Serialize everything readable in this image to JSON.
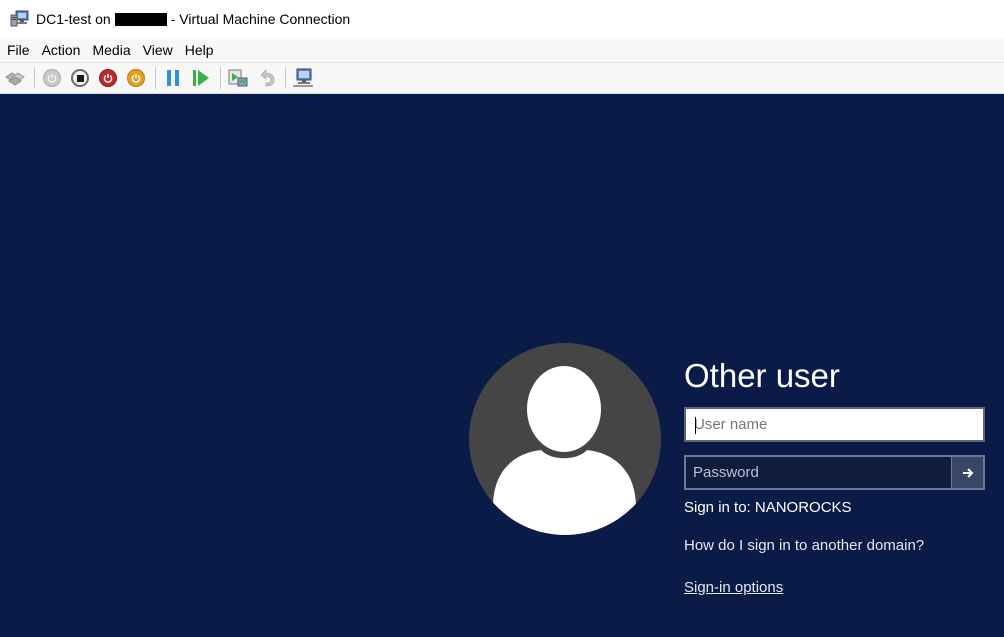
{
  "window": {
    "title_prefix": "DC1-test on",
    "title_suffix": "- Virtual Machine Connection",
    "app_icon": "vm-connection-icon"
  },
  "menu": {
    "items": [
      "File",
      "Action",
      "Media",
      "View",
      "Help"
    ]
  },
  "toolbar": {
    "buttons": [
      "ctrl-alt-del-icon",
      "start-icon",
      "turn-off-icon",
      "shut-down-icon",
      "save-icon",
      "pause-icon",
      "resume-icon",
      "checkpoint-icon",
      "revert-icon",
      "enhanced-session-icon"
    ]
  },
  "login": {
    "title": "Other user",
    "username_placeholder": "User name",
    "password_placeholder": "Password",
    "submit_icon": "arrow-right-icon",
    "sign_in_to": "Sign in to: NANOROCKS",
    "other_domain": "How do I sign in to another domain?",
    "sign_in_options": "Sign-in options"
  },
  "colors": {
    "vm_background": "#0b1b48",
    "avatar_background": "#454545",
    "stop_red": "#c0282d",
    "save_orange": "#e3a11c",
    "play_green": "#37b34a",
    "pause_blue": "#2f8fd8"
  }
}
